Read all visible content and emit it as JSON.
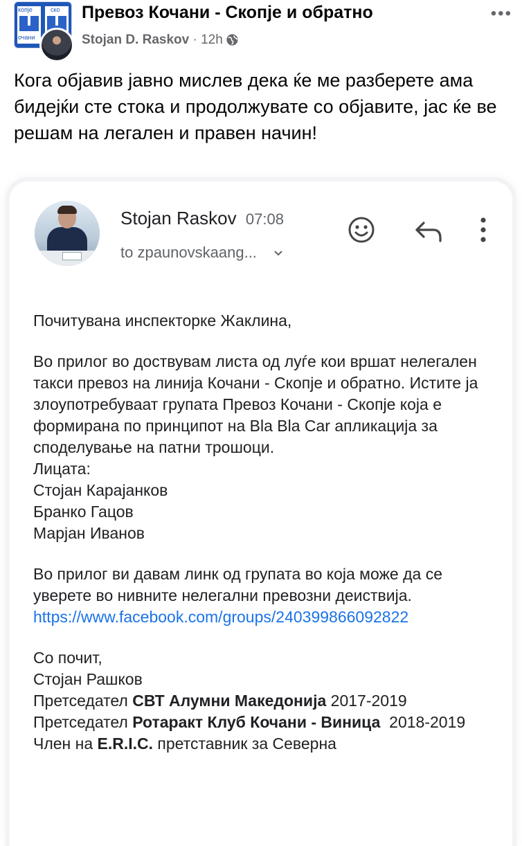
{
  "post": {
    "group_name": "Превоз Кочани - Скопје и обратно",
    "author": "Stojan D. Raskov",
    "separator": " · ",
    "time": "12h",
    "audience_icon": "globe-icon",
    "more_icon": "•••",
    "text": "Кога објавив јавно мислев дека ќе ме разберете ама бидејќи сте стока и продолжувате со објавите, јас ќе ве решам на легален и правен начин!",
    "group_avatar_text": [
      "копје",
      "ско",
      "очани"
    ]
  },
  "email": {
    "sender": "Stojan Raskov",
    "time": "07:08",
    "recipient": "to zpaunovskaang...",
    "greeting": "Почитувана инспекторке Жаклина,",
    "paragraph1": "Во прилог во доствувам листа од луѓе кои вршат нелегален такси превоз на линија Кочани - Скопје и обратно. Истите ја злоупотребуваат групата Превоз Кочани - Скопје која е формирана по принципот на Bla Bla Car апликација за споделување на патни трошоци.",
    "persons_label": "Лицата:",
    "persons": [
      "Стојан Карајанков",
      "Бранко Гацов",
      "Марјан Иванов"
    ],
    "paragraph2": "Во прилог ви давам линк од групата во која може да се уверете во нивните нелегални превозни деиствија.",
    "link": "https://www.facebook.com/groups/240399866092822",
    "closing": "Со почит,",
    "signature_name": "Стојан Рашков",
    "roles": [
      {
        "prefix": "Претседател ",
        "org": "СВТ Алумни Македонија",
        "suffix": " 2017-2019"
      },
      {
        "prefix": "Претседател ",
        "org": "Ротаракт Клуб Кочани - Виница",
        "suffix": "  2018-2019"
      },
      {
        "prefix": "Член на ",
        "org": "E.R.I.C.",
        "suffix": " претставник за Северна"
      }
    ]
  }
}
